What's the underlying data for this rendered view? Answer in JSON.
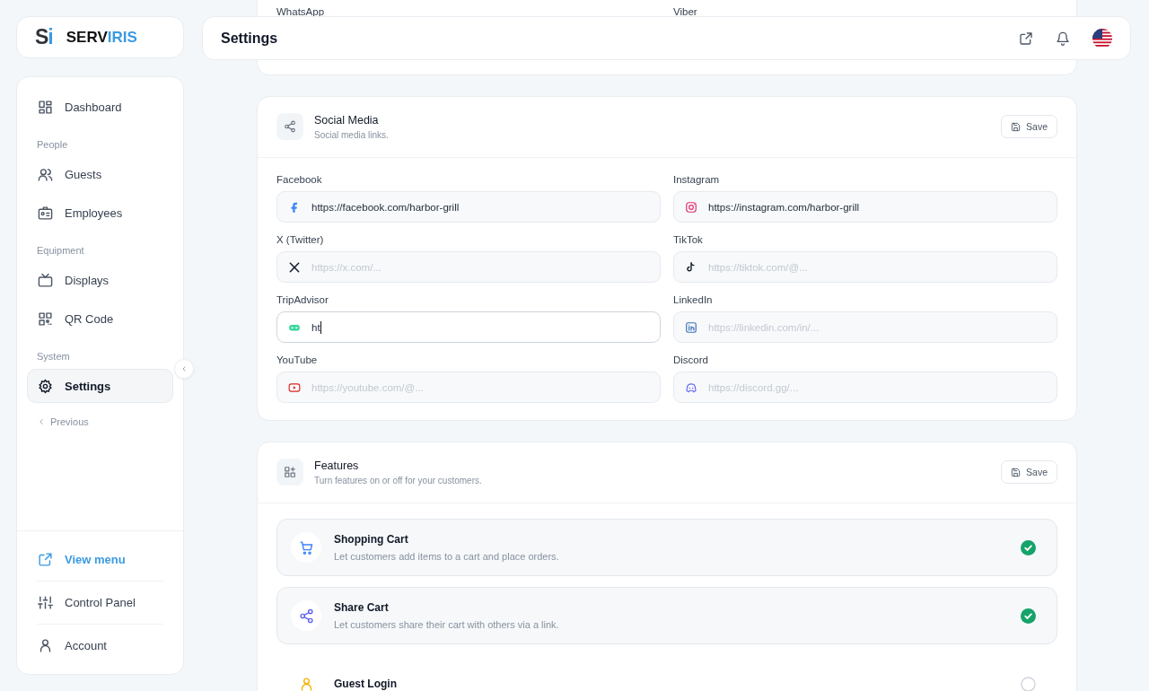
{
  "brand": {
    "mark": "Si",
    "name_dark": "SERV",
    "name_accent": "IRIS"
  },
  "sidebar": {
    "groups": [
      {
        "items": [
          {
            "label": "Dashboard",
            "kind": "grid",
            "selected": false
          }
        ]
      },
      {
        "heading": "People",
        "items": [
          {
            "label": "Guests",
            "kind": "users",
            "selected": false
          },
          {
            "label": "Employees",
            "kind": "badge",
            "selected": false
          }
        ]
      },
      {
        "heading": "Equipment",
        "items": [
          {
            "label": "Displays",
            "kind": "tv",
            "selected": false
          },
          {
            "label": "QR Code",
            "kind": "qr",
            "selected": false
          }
        ]
      },
      {
        "heading": "System",
        "items": [
          {
            "label": "Settings",
            "kind": "gear",
            "selected": true
          }
        ]
      }
    ],
    "previous": "Previous",
    "footer": [
      {
        "label": "View menu",
        "kind": "external"
      },
      {
        "label": "Control Panel",
        "kind": "sliders"
      },
      {
        "label": "Account",
        "kind": "user"
      }
    ]
  },
  "header": {
    "title": "Settings"
  },
  "top_card": {
    "labels": [
      "WhatsApp",
      "Viber"
    ]
  },
  "social_card": {
    "title": "Social Media",
    "subtitle": "Social media links.",
    "save": "Save",
    "fields": [
      {
        "label": "Facebook",
        "kind": "facebook",
        "value": "https://facebook.com/harbor-grill",
        "focused": false
      },
      {
        "label": "Instagram",
        "kind": "instagram",
        "value": "https://instagram.com/harbor-grill",
        "focused": false
      },
      {
        "label": "X (Twitter)",
        "kind": "x",
        "placeholder": "https://x.com/...",
        "focused": false
      },
      {
        "label": "TikTok",
        "kind": "tiktok",
        "placeholder": "https://tiktok.com/@...",
        "focused": false
      },
      {
        "label": "TripAdvisor",
        "kind": "tripadvisor",
        "value": "ht",
        "focused": true
      },
      {
        "label": "LinkedIn",
        "kind": "linkedin",
        "placeholder": "https://linkedin.com/in/...",
        "focused": false
      },
      {
        "label": "YouTube",
        "kind": "youtube",
        "placeholder": "https://youtube.com/@...",
        "focused": false
      },
      {
        "label": "Discord",
        "kind": "discord",
        "placeholder": "https://discord.gg/...",
        "focused": false
      }
    ]
  },
  "features_card": {
    "title": "Features",
    "subtitle": "Turn features on or off for your customers.",
    "save": "Save",
    "features": [
      {
        "title": "Shopping Cart",
        "description": "Let customers add items to a cart and place orders.",
        "kind": "cart",
        "checked": true
      },
      {
        "title": "Share Cart",
        "description": "Let customers share their cart with others via a link.",
        "kind": "share",
        "checked": true
      },
      {
        "title": "Guest Login",
        "kind": "user",
        "checked": false
      }
    ]
  }
}
